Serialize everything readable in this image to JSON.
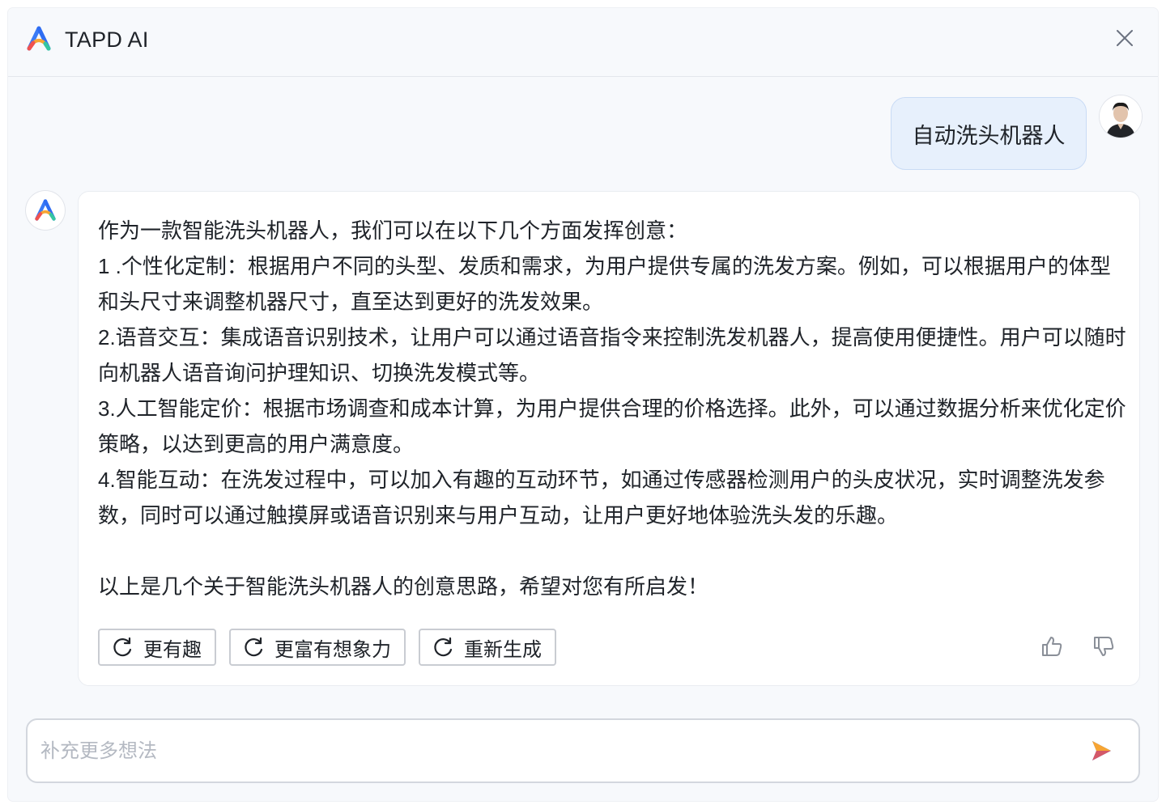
{
  "header": {
    "title": "TAPD AI",
    "logo_icon": "tapd-ai-logo-icon",
    "close_icon": "close-icon"
  },
  "conversation": {
    "user_message": "自动洗头机器人",
    "ai_message": {
      "paragraphs": [
        "作为一款智能洗头机器人，我们可以在以下几个方面发挥创意：",
        "1 .个性化定制：根据用户不同的头型、发质和需求，为用户提供专属的洗发方案。例如，可以根据用户的体型和头尺寸来调整机器尺寸，直至达到更好的洗发效果。",
        "2.语音交互：集成语音识别技术，让用户可以通过语音指令来控制洗发机器人，提高使用便捷性。用户可以随时向机器人语音询问护理知识、切换洗发模式等。",
        "3.人工智能定价：根据市场调查和成本计算，为用户提供合理的价格选择。此外，可以通过数据分析来优化定价策略，以达到更高的用户满意度。",
        "4.智能互动：在洗发过程中，可以加入有趣的互动环节，如通过传感器检测用户的头皮状况，实时调整洗发参数，同时可以通过触摸屏或语音识别来与用户互动，让用户更好地体验洗头发的乐趣。"
      ],
      "closing": "以上是几个关于智能洗头机器人的创意思路，希望对您有所启发！"
    },
    "actions": {
      "more_fun": "更有趣",
      "more_imaginative": "更富有想象力",
      "regenerate": "重新生成",
      "refresh_icon": "refresh-icon"
    },
    "feedback": {
      "like_icon": "thumbs-up-icon",
      "dislike_icon": "thumbs-down-icon"
    }
  },
  "input": {
    "placeholder": "补充更多想法",
    "value": "",
    "send_icon": "send-icon"
  },
  "colors": {
    "panel_bg": "#f7f9fc",
    "user_bubble_bg": "#e7f0fc",
    "accent_blue": "#3a7bf6",
    "accent_red": "#f0524f",
    "accent_orange": "#f7a533"
  }
}
